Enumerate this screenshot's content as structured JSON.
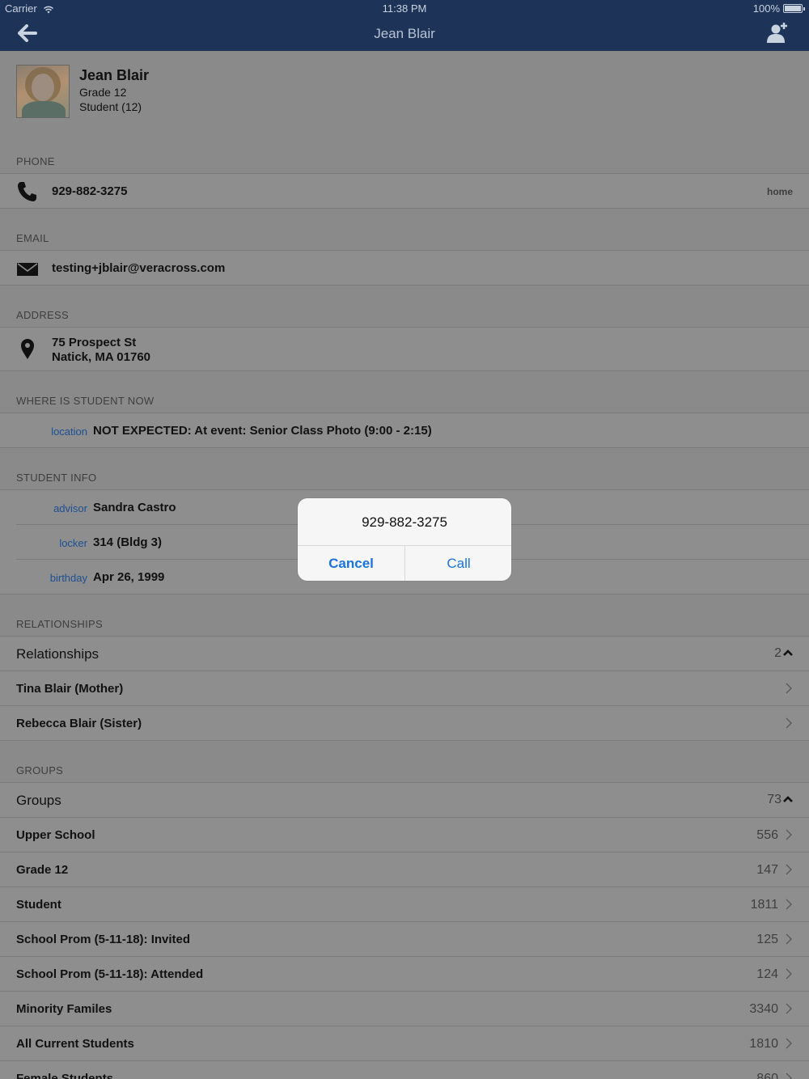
{
  "status_bar": {
    "carrier": "Carrier",
    "time": "11:38 PM",
    "battery": "100%"
  },
  "nav": {
    "title": "Jean Blair"
  },
  "profile": {
    "name": "Jean Blair",
    "grade": "Grade 12",
    "role": "Student (12)"
  },
  "phone": {
    "header": "PHONE",
    "number": "929-882-3275",
    "type": "home"
  },
  "email": {
    "header": "EMAIL",
    "address": "testing+jblair@veracross.com"
  },
  "address": {
    "header": "ADDRESS",
    "line1": "75 Prospect St",
    "line2": "Natick, MA 01760"
  },
  "where": {
    "header": "WHERE IS STUDENT NOW",
    "label": "location",
    "value": "NOT EXPECTED: At event: Senior Class Photo (9:00 - 2:15)"
  },
  "student_info": {
    "header": "STUDENT INFO",
    "rows": [
      {
        "label": "advisor",
        "value": "Sandra Castro"
      },
      {
        "label": "locker",
        "value": "314 (Bldg 3)"
      },
      {
        "label": "birthday",
        "value": "Apr 26, 1999"
      }
    ]
  },
  "relationships": {
    "header": "RELATIONSHIPS",
    "title": "Relationships",
    "count": "2",
    "items": [
      "Tina Blair (Mother)",
      "Rebecca Blair (Sister)"
    ]
  },
  "groups": {
    "header": "GROUPS",
    "title": "Groups",
    "count": "73",
    "items": [
      {
        "name": "Upper School",
        "count": "556"
      },
      {
        "name": "Grade 12",
        "count": "147"
      },
      {
        "name": "Student",
        "count": "1811"
      },
      {
        "name": "School Prom (5-11-18): Invited",
        "count": "125"
      },
      {
        "name": "School Prom (5-11-18): Attended",
        "count": "124"
      },
      {
        "name": "Minority Familes",
        "count": "3340"
      },
      {
        "name": "All Current Students",
        "count": "1810"
      },
      {
        "name": "Female Students",
        "count": "860"
      }
    ]
  },
  "alert": {
    "title": "929-882-3275",
    "cancel_label": "Cancel",
    "call_label": "Call"
  }
}
